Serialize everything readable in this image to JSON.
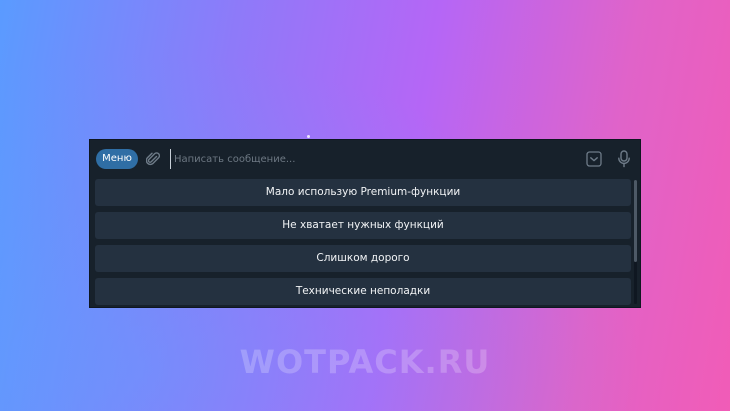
{
  "input_bar": {
    "menu_label": "Меню",
    "placeholder": "Написать сообщение...",
    "attach_icon": "paperclip-icon",
    "keyboard_icon": "keyboard-toggle-icon",
    "mic_icon": "microphone-icon"
  },
  "keyboard": {
    "buttons": [
      {
        "label": "Мало использую Premium-функции"
      },
      {
        "label": "Не хватает нужных функций"
      },
      {
        "label": "Слишком дорого"
      },
      {
        "label": "Технические неполадки"
      }
    ]
  },
  "watermark": "WOTPACK.RU",
  "colors": {
    "panel_bg": "#17212b",
    "button_bg": "#243140",
    "menu_button": "#2f6ea5"
  }
}
